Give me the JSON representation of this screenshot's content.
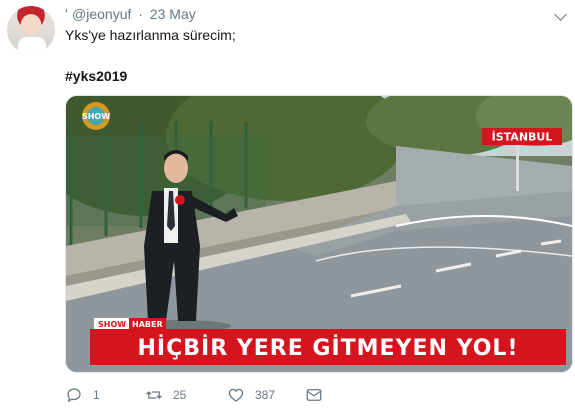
{
  "tweet": {
    "name": "ʻ",
    "handle": "@jeonyuf",
    "separator": "·",
    "date": "23 May",
    "text": "Yks'ye hazırlanma sürecim;",
    "hashtag": "#yks2019"
  },
  "media": {
    "channel_logo": "SHOW",
    "road_sign": "İSTANBUL",
    "banner_channel": "SHOW",
    "banner_section": "HABER",
    "banner_headline": "HİÇBİR YERE GİTMEYEN YOL!"
  },
  "actions": {
    "reply_count": "1",
    "retweet_count": "25",
    "like_count": "387",
    "icons": [
      "reply-icon",
      "retweet-icon",
      "like-icon",
      "message-icon"
    ]
  },
  "colors": {
    "text_primary": "#14171a",
    "text_secondary": "#657786",
    "banner_red": "#d4151d"
  }
}
